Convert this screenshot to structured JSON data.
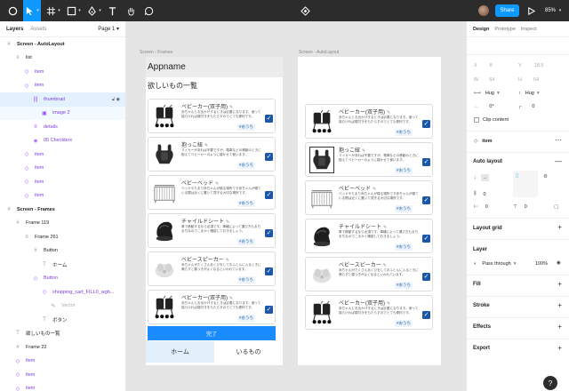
{
  "toolbar": {
    "share_label": "Share",
    "zoom": "85%"
  },
  "left_panel": {
    "tab_layers": "Layers",
    "tab_assets": "Assets",
    "page": "Page 1",
    "layers": [
      {
        "label": "Screen - AutoLayout",
        "indent": 0,
        "icon": "#",
        "bold": true
      },
      {
        "label": "list",
        "indent": 1,
        "icon": "≡"
      },
      {
        "label": "item",
        "indent": 2,
        "icon": "◇",
        "purple": true
      },
      {
        "label": "item",
        "indent": 2,
        "icon": "◇",
        "purple": true
      },
      {
        "label": "thumbnail",
        "indent": 3,
        "icon": "|||",
        "purple": true,
        "state": "sel"
      },
      {
        "label": "image 2",
        "indent": 4,
        "icon": "▣",
        "purple": true,
        "state": "sub"
      },
      {
        "label": "details",
        "indent": 3,
        "icon": "≡",
        "purple": true
      },
      {
        "label": "05 Checkbox",
        "indent": 3,
        "icon": "◈",
        "purple": true
      },
      {
        "label": "item",
        "indent": 2,
        "icon": "◇",
        "purple": true
      },
      {
        "label": "item",
        "indent": 2,
        "icon": "◇",
        "purple": true
      },
      {
        "label": "item",
        "indent": 2,
        "icon": "◇",
        "purple": true
      },
      {
        "label": "item",
        "indent": 2,
        "icon": "◇",
        "purple": true
      },
      {
        "label": "Screen - Frames",
        "indent": 0,
        "icon": "#",
        "bold": true
      },
      {
        "label": "Frame 119",
        "indent": 1,
        "icon": "#"
      },
      {
        "label": "Frame 261",
        "indent": 2,
        "icon": "≡"
      },
      {
        "label": "Button",
        "indent": 3,
        "icon": "#"
      },
      {
        "label": "ホーム",
        "indent": 4,
        "icon": "T"
      },
      {
        "label": "Button",
        "indent": 3,
        "icon": "◇",
        "purple": true
      },
      {
        "label": "shopping_cart_FILL0_wgh...",
        "indent": 4,
        "icon": "◇",
        "purple": true
      },
      {
        "label": "Vector",
        "indent": 5,
        "icon": "✎",
        "grey": true
      },
      {
        "label": "ボタン",
        "indent": 4,
        "icon": "T"
      },
      {
        "label": "欲しいもの一覧",
        "indent": 1,
        "icon": "T"
      },
      {
        "label": "Frame 22",
        "indent": 1,
        "icon": "#"
      },
      {
        "label": "item",
        "indent": 1,
        "icon": "◇",
        "purple": true
      },
      {
        "label": "item",
        "indent": 1,
        "icon": "◇",
        "purple": true
      },
      {
        "label": "item",
        "indent": 1,
        "icon": "◇",
        "purple": true
      }
    ]
  },
  "canvas": {
    "frame1_label": "Screen - Frames",
    "frame2_label": "Screen - AutoLayout",
    "app_title": "Appname",
    "wishlist_title": "欲しいもの一覧",
    "done_button": "完了",
    "nav_home": "ホーム",
    "nav_have": "いるもの",
    "tag": "#おうち",
    "items": [
      {
        "title": "ベビーカー(双子用)",
        "desc": "赤ちゃんとお出かけするときは必要になります。使って揺らければ寝付きをもたらすのでとても便利です。",
        "img": "stroller"
      },
      {
        "title": "抱っこ紐",
        "desc": "マイカーがあれば不要ですが、電車などの移動のときに抱えてベビーカーのように寝かせて使います。",
        "img": "carrier"
      },
      {
        "title": "ベビーベッド",
        "desc": "ベッドやたまり赤ちゃんが寝る場所です赤ちゃんが寝ている間は近くに置いて見守る大切な場所です。",
        "img": "crib"
      },
      {
        "title": "チャイルドシート",
        "desc": "車で移動するなら必須です。車種によって選び方もまちまちなのでこまかく確認しておきましょう。",
        "img": "carseat"
      },
      {
        "title": "ベビースピーカー",
        "desc": "赤ちゃんがたくさんあくびをしておふとんに入るときに鳴らすと寝つきがよくなるといわれています。",
        "img": "speaker"
      },
      {
        "title": "ベビーカー(双子用)",
        "desc": "赤ちゃんとお出かけするときは必要になります。使って揺らければ寝付きをもたらすのでとても便利です。",
        "img": "stroller"
      }
    ]
  },
  "right_panel": {
    "tab_design": "Design",
    "tab_prototype": "Prototype",
    "tab_inspect": "Inspect",
    "x_label": "X",
    "x_val": "8",
    "y_label": "Y",
    "y_val": "18.5",
    "w_label": "W",
    "w_val": "64",
    "h_label": "H",
    "h_val": "64",
    "hug1": "Hug",
    "hug2": "Hug",
    "angle": "0°",
    "radius": "0",
    "clip": "Clip content",
    "component": "item",
    "auto_layout": "Auto layout",
    "spacing": "0",
    "pad_h": "0",
    "pad_v": "0",
    "layout_grid": "Layout grid",
    "layer": "Layer",
    "blend": "Pass through",
    "opacity": "100%",
    "fill": "Fill",
    "stroke": "Stroke",
    "effects": "Effects",
    "export": "Export"
  },
  "help": "?"
}
